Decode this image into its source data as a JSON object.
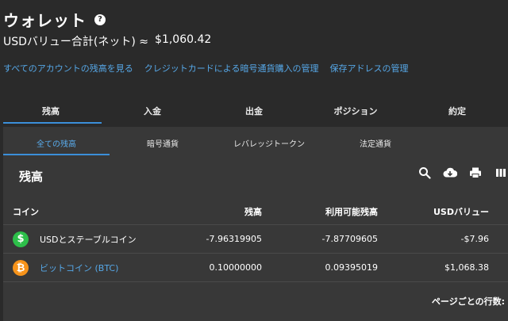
{
  "page": {
    "title": "ウォレット",
    "usd_label": "USDバリュー合計(ネット) ≈",
    "usd_total": "$1,060.42"
  },
  "links": [
    "すべてのアカウントの残高を見る",
    "クレジットカードによる暗号通貨購入の管理",
    "保存アドレスの管理"
  ],
  "tabs": [
    "残高",
    "入金",
    "出金",
    "ポジション",
    "約定"
  ],
  "subtabs": [
    "全ての残高",
    "暗号通貨",
    "レバレッジトークン",
    "法定通貨"
  ],
  "panel": {
    "title": "残高",
    "toolbar_icons": [
      "search-icon",
      "download-icon",
      "print-icon",
      "columns-icon"
    ]
  },
  "table": {
    "headers": {
      "coin": "コイン",
      "balance": "残高",
      "available": "利用可能残高",
      "usd": "USDバリュー"
    },
    "rows": [
      {
        "icon": "dollar-coin-icon",
        "icon_glyph": "$",
        "icon_color": "#2dbf4a",
        "name": "USDとステーブルコイン",
        "balance": "-7.96319905",
        "available": "-7.87709605",
        "usd": "-$7.96"
      },
      {
        "icon": "bitcoin-icon",
        "icon_glyph": "₿",
        "icon_color": "#f7931a",
        "name": "ビットコイン (BTC)",
        "balance": "0.10000000",
        "available": "0.09395019",
        "usd": "$1,068.38"
      }
    ]
  },
  "footer": {
    "rows_per_page": "ページごとの行数:"
  },
  "colors": {
    "background": "#2a2a2a",
    "panel": "#383838",
    "link": "#56a8e8",
    "accent": "#3b8fd9"
  }
}
